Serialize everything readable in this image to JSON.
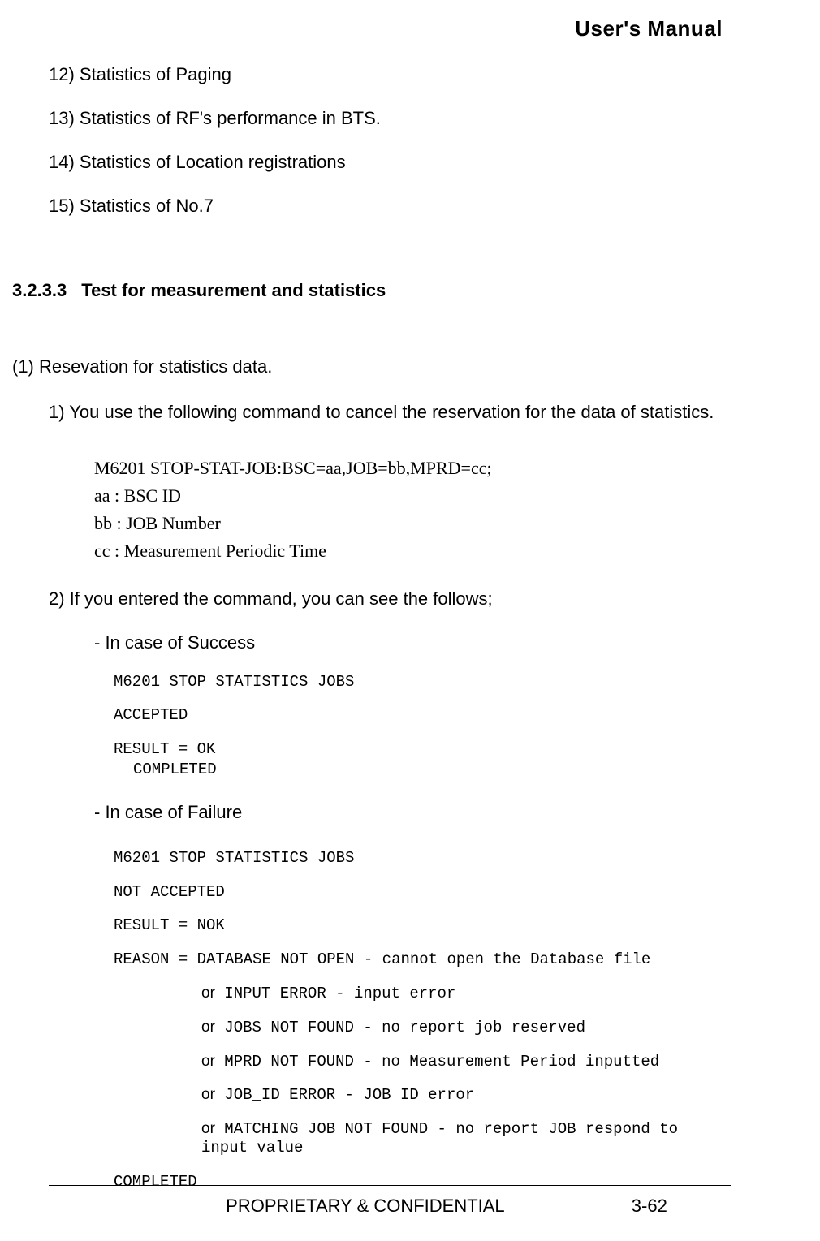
{
  "header": {
    "title": "User's Manual"
  },
  "list": {
    "item12": "12) Statistics of Paging",
    "item13": "13) Statistics of RF's performance in BTS.",
    "item14": "14) Statistics of Location registrations",
    "item15": "15) Statistics of No.7"
  },
  "section": {
    "number": "3.2.3.3",
    "title": "Test for measurement and statistics"
  },
  "subsection": {
    "title": "(1) Resevation for statistics data.",
    "step1": "1) You use the following command to cancel the reservation for the data of statistics.",
    "step2": "2) If you entered the command, you can see the follows;"
  },
  "command": {
    "main": "M6201 STOP-STAT-JOB:BSC=aa,JOB=bb,MPRD=cc;",
    "paramA": "aa : BSC ID",
    "paramB": "bb : JOB Number",
    "paramC": "cc : Measurement Periodic Time"
  },
  "cases": {
    "success": {
      "label": "- In case of Success",
      "line1": "M6201 STOP STATISTICS JOBS",
      "line2": "ACCEPTED",
      "line3": "RESULT = OK",
      "line4": "COMPLETED"
    },
    "failure": {
      "label": "- In case of Failure",
      "line1": "M6201 STOP STATISTICS JOBS",
      "line2": "NOT ACCEPTED",
      "line3": "RESULT = NOK",
      "reason_prefix": "REASON = ",
      "reason1": "DATABASE NOT OPEN - cannot open the Database file",
      "or": "or",
      "reason2": " INPUT ERROR - input error",
      "reason3": " JOBS NOT FOUND - no report job reserved",
      "reason4": " MPRD NOT FOUND - no Measurement Period inputted",
      "reason5": " JOB_ID ERROR - JOB ID error",
      "reason6": " MATCHING JOB NOT FOUND - no report JOB respond to input value",
      "completed": "COMPLETED"
    }
  },
  "footer": {
    "label": "PROPRIETARY & CONFIDENTIAL",
    "page": "3-62"
  }
}
